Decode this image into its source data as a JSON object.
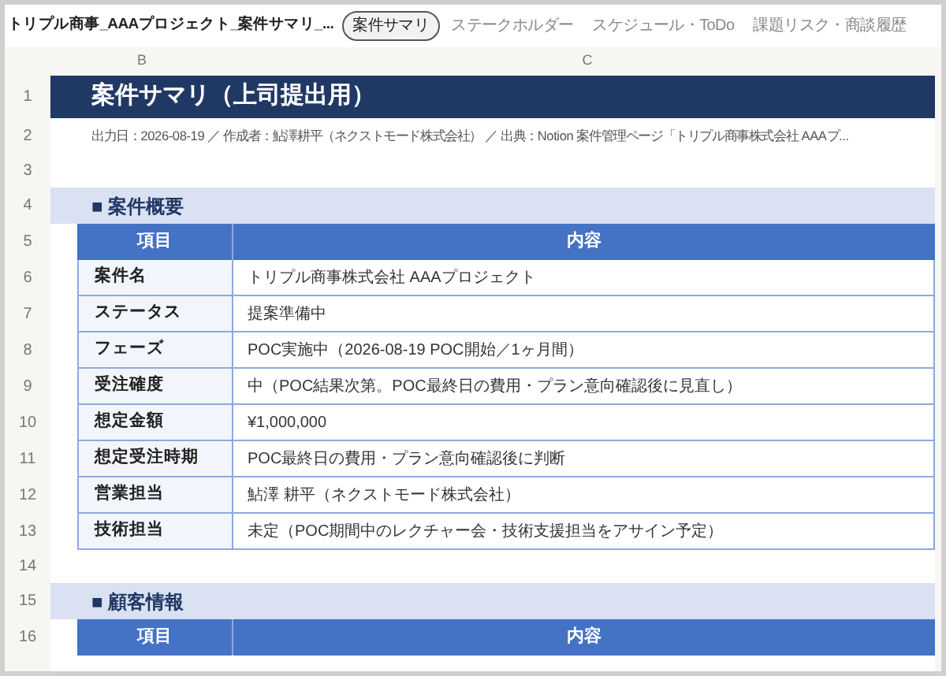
{
  "file_title": "トリプル商事_AAAプロジェクト_案件サマリ_...",
  "tabs": [
    {
      "label": "案件サマリ",
      "selected": true
    },
    {
      "label": "ステークホルダー",
      "selected": false
    },
    {
      "label": "スケジュール・ToDo",
      "selected": false
    },
    {
      "label": "課題リスク・商談履歴",
      "selected": false
    }
  ],
  "columns": [
    "B",
    "C"
  ],
  "rows": [
    {
      "number": "1",
      "kind": "title",
      "text": "案件サマリ（上司提出用）"
    },
    {
      "number": "2",
      "kind": "meta",
      "text": "出力日：2026-08-19 ／ 作成者：鮎澤耕平（ネクストモード株式会社） ／ 出典：Notion 案件管理ページ「トリプル商事株式会社 AAAプ..."
    },
    {
      "number": "3",
      "kind": "blank"
    },
    {
      "number": "4",
      "kind": "section",
      "text": "■ 案件概要"
    },
    {
      "number": "5",
      "kind": "header",
      "cells": [
        "項目",
        "内容"
      ]
    },
    {
      "number": "6",
      "kind": "row",
      "cells": [
        "案件名",
        "トリプル商事株式会社 AAAプロジェクト"
      ]
    },
    {
      "number": "7",
      "kind": "row",
      "cells": [
        "ステータス",
        "提案準備中"
      ]
    },
    {
      "number": "8",
      "kind": "row",
      "cells": [
        "フェーズ",
        "POC実施中（2026-08-19 POC開始／1ヶ月間）"
      ]
    },
    {
      "number": "9",
      "kind": "row",
      "cells": [
        "受注確度",
        "中（POC結果次第。POC最終日の費用・プラン意向確認後に見直し）"
      ]
    },
    {
      "number": "10",
      "kind": "row",
      "cells": [
        "想定金額",
        "¥1,000,000"
      ]
    },
    {
      "number": "11",
      "kind": "row",
      "cells": [
        "想定受注時期",
        "POC最終日の費用・プラン意向確認後に判断"
      ]
    },
    {
      "number": "12",
      "kind": "row",
      "cells": [
        "営業担当",
        "鮎澤 耕平（ネクストモード株式会社）"
      ]
    },
    {
      "number": "13",
      "kind": "row",
      "cells": [
        "技術担当",
        "未定（POC期間中のレクチャー会・技術支援担当をアサイン予定）"
      ]
    },
    {
      "number": "14",
      "kind": "blank"
    },
    {
      "number": "15",
      "kind": "section",
      "text": "■ 顧客情報"
    },
    {
      "number": "16",
      "kind": "header",
      "cells": [
        "項目",
        "内容"
      ]
    }
  ]
}
